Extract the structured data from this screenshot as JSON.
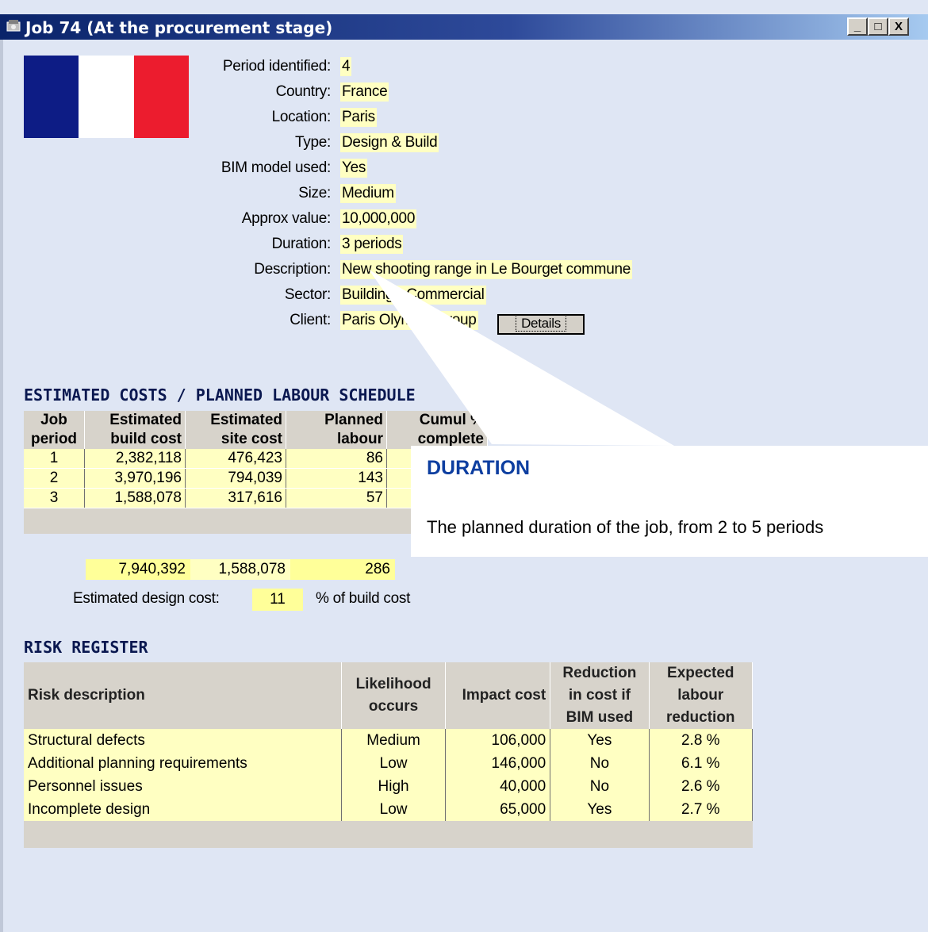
{
  "window": {
    "title": "Job 74  (At the procurement stage)",
    "minimize_label": "_",
    "maximize_label": "□",
    "close_label": "X"
  },
  "flag_colors": [
    "#0d1c85",
    "#ffffff",
    "#ec1c2e"
  ],
  "fields": [
    {
      "label": "Period identified:",
      "value": "4"
    },
    {
      "label": "Country:",
      "value": "France"
    },
    {
      "label": "Location:",
      "value": "Paris"
    },
    {
      "label": "Type:",
      "value": "Design & Build"
    },
    {
      "label": "BIM model used:",
      "value": "Yes"
    },
    {
      "label": "Size:",
      "value": "Medium"
    },
    {
      "label": "Approx value:",
      "value": "10,000,000"
    },
    {
      "label": "Duration:",
      "value": "3 periods"
    },
    {
      "label": "Description:",
      "value": "New shooting range in Le Bourget commune"
    },
    {
      "label": "Sector:",
      "value": "Building - Commercial"
    },
    {
      "label": "Client:",
      "value": "Paris Olympic Group"
    }
  ],
  "details_button": "Details",
  "cost_section": {
    "heading": "ESTIMATED COSTS / PLANNED LABOUR SCHEDULE",
    "headers": [
      [
        "Job",
        "period"
      ],
      [
        "Estimated",
        "build cost"
      ],
      [
        "Estimated",
        "site cost"
      ],
      [
        "Planned",
        "labour"
      ],
      [
        "Cumul %",
        "complete"
      ]
    ],
    "rows": [
      [
        "1",
        "2,382,118",
        "476,423",
        "86",
        ""
      ],
      [
        "2",
        "3,970,196",
        "794,039",
        "143",
        ""
      ],
      [
        "3",
        "1,588,078",
        "317,616",
        "57",
        ""
      ]
    ],
    "totals": {
      "build": "7,940,392",
      "site": "1,588,078",
      "labour": "286"
    },
    "design_label": "Estimated design cost:",
    "design_value": "11",
    "design_unit": "% of build cost"
  },
  "risk_section": {
    "heading": "RISK REGISTER",
    "headers": {
      "description": "Risk description",
      "likelihood": "Likelihood occurs",
      "impact": "Impact cost",
      "reduction": "Reduction in cost if BIM used",
      "expected": "Expected labour reduction"
    },
    "rows": [
      {
        "description": "Structural defects",
        "likelihood": "Medium",
        "impact": "106,000",
        "reduction": "Yes",
        "expected": "2.8 %"
      },
      {
        "description": "Additional planning requirements",
        "likelihood": "Low",
        "impact": "146,000",
        "reduction": "No",
        "expected": "6.1 %"
      },
      {
        "description": "Personnel issues",
        "likelihood": "High",
        "impact": "40,000",
        "reduction": "No",
        "expected": "2.6 %"
      },
      {
        "description": "Incomplete design",
        "likelihood": "Low",
        "impact": "65,000",
        "reduction": "Yes",
        "expected": "2.7 %"
      }
    ]
  },
  "tooltip": {
    "title": "DURATION",
    "text": "The planned duration of the job, from 2 to 5 periods"
  }
}
